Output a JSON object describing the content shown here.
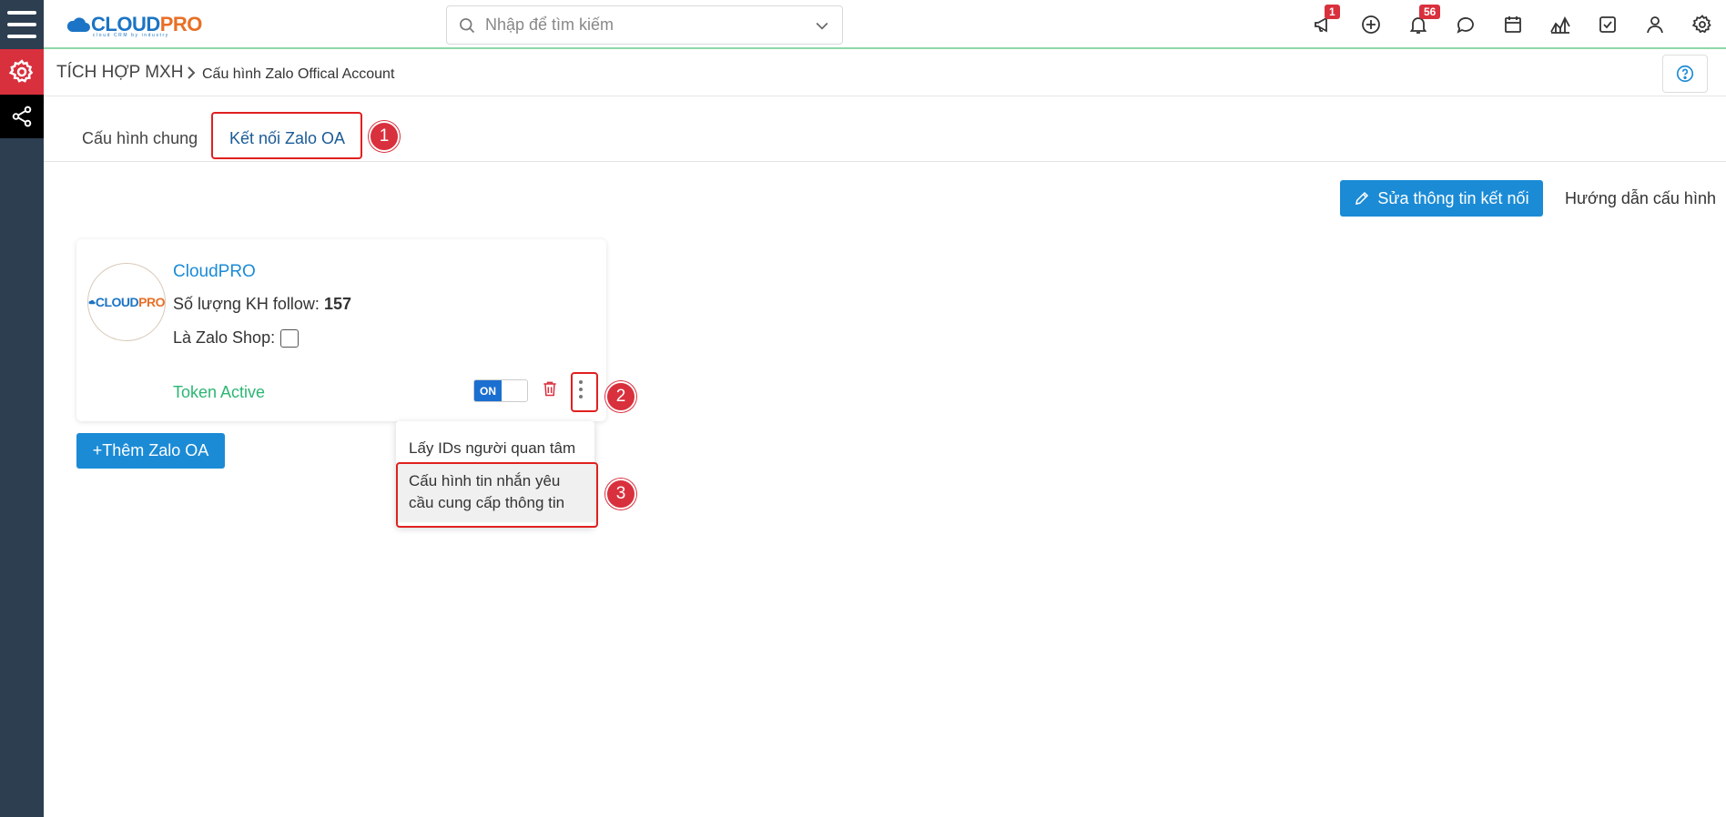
{
  "topbar": {
    "brand_part1": "CLOUD",
    "brand_part2": "PRO",
    "brand_tagline": "cloud CRM by industry",
    "search_placeholder": "Nhập để tìm kiếm",
    "announcement_badge": "1",
    "notification_badge": "56"
  },
  "breadcrumb": {
    "main": "TÍCH HỢP MXH",
    "sub": "Cấu hình Zalo Offical Account"
  },
  "tabs": [
    {
      "label": "Cấu hình chung",
      "active": false
    },
    {
      "label": "Kết nối Zalo OA",
      "active": true
    }
  ],
  "actions": {
    "edit_label": "Sửa thông tin kết nối",
    "guide_label": "Hướng dẫn cấu hình"
  },
  "oa_card": {
    "name": "CloudPRO",
    "followers_label": "Số lượng KH follow:",
    "followers_value": "157",
    "shop_label": "Là Zalo Shop:",
    "token_status": "Token Active",
    "toggle_label": "ON"
  },
  "add_button": "+Thêm Zalo OA",
  "dropdown": {
    "items": [
      "Lấy IDs người quan tâm",
      "Cấu hình tin nhắn yêu cầu cung cấp thông tin"
    ]
  },
  "annotations": [
    "1",
    "2",
    "3"
  ],
  "colors": {
    "primary": "#1b8bd6",
    "danger": "#d9303d",
    "success": "#2bb673",
    "rail": "#2c3e50"
  }
}
